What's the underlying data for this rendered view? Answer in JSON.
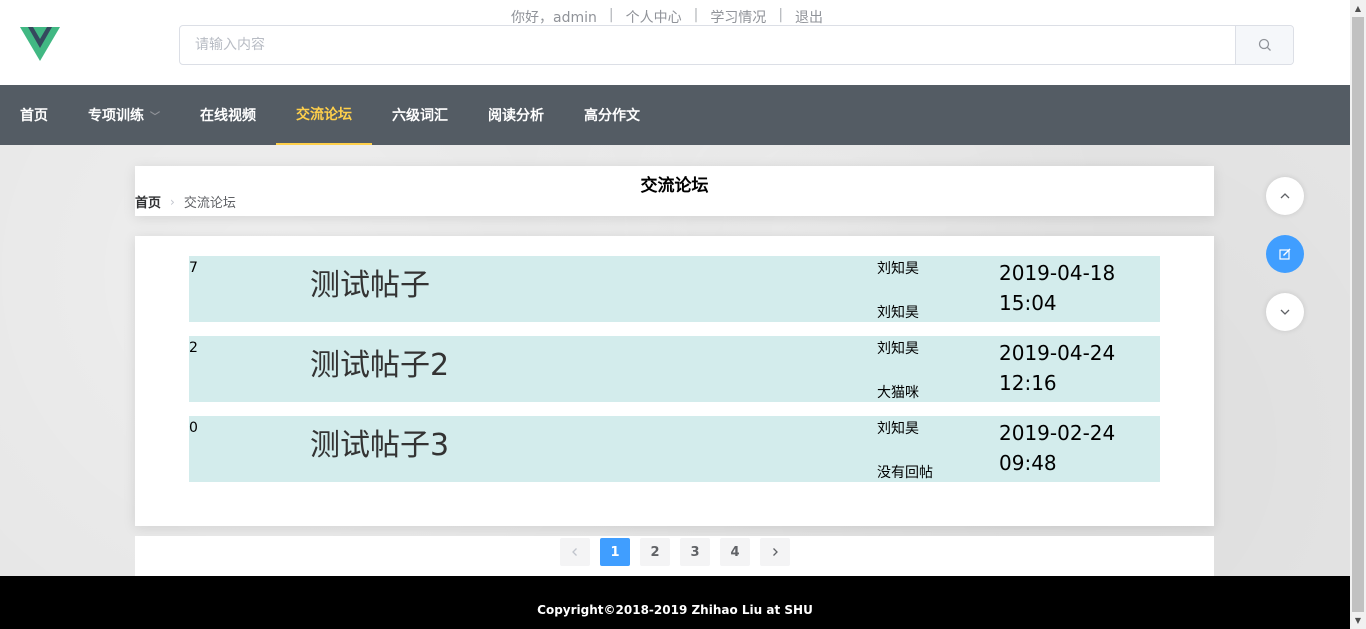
{
  "header": {
    "greeting": "你好，admin",
    "links": [
      "个人中心",
      "学习情况",
      "退出"
    ],
    "separator": "|",
    "search_placeholder": "请输入内容"
  },
  "nav": {
    "items": [
      {
        "label": "首页",
        "active": false
      },
      {
        "label": "专项训练",
        "active": false,
        "dropdown": true
      },
      {
        "label": "在线视频",
        "active": false
      },
      {
        "label": "交流论坛",
        "active": true
      },
      {
        "label": "六级词汇",
        "active": false
      },
      {
        "label": "阅读分析",
        "active": false
      },
      {
        "label": "高分作文",
        "active": false
      }
    ]
  },
  "page": {
    "title": "交流论坛",
    "breadcrumb": {
      "home": "首页",
      "current": "交流论坛"
    }
  },
  "posts": [
    {
      "count": "7",
      "title": "测试帖子",
      "author": "刘知昊",
      "last_replier": "刘知昊",
      "date": "2019-04-18",
      "time": "15:04"
    },
    {
      "count": "2",
      "title": "测试帖子2",
      "author": "刘知昊",
      "last_replier": "大猫咪",
      "date": "2019-04-24",
      "time": "12:16"
    },
    {
      "count": "0",
      "title": "测试帖子3",
      "author": "刘知昊",
      "last_replier": "没有回帖",
      "date": "2019-02-24",
      "time": "09:48"
    }
  ],
  "pagination": {
    "pages": [
      "1",
      "2",
      "3",
      "4"
    ],
    "current": "1"
  },
  "footer": {
    "text": "Copyright©2018-2019 Zhihao Liu at SHU"
  },
  "colors": {
    "nav_bg": "#545c64",
    "nav_active": "#ffd04b",
    "primary": "#409eff",
    "post_bg": "#d3ecec"
  }
}
